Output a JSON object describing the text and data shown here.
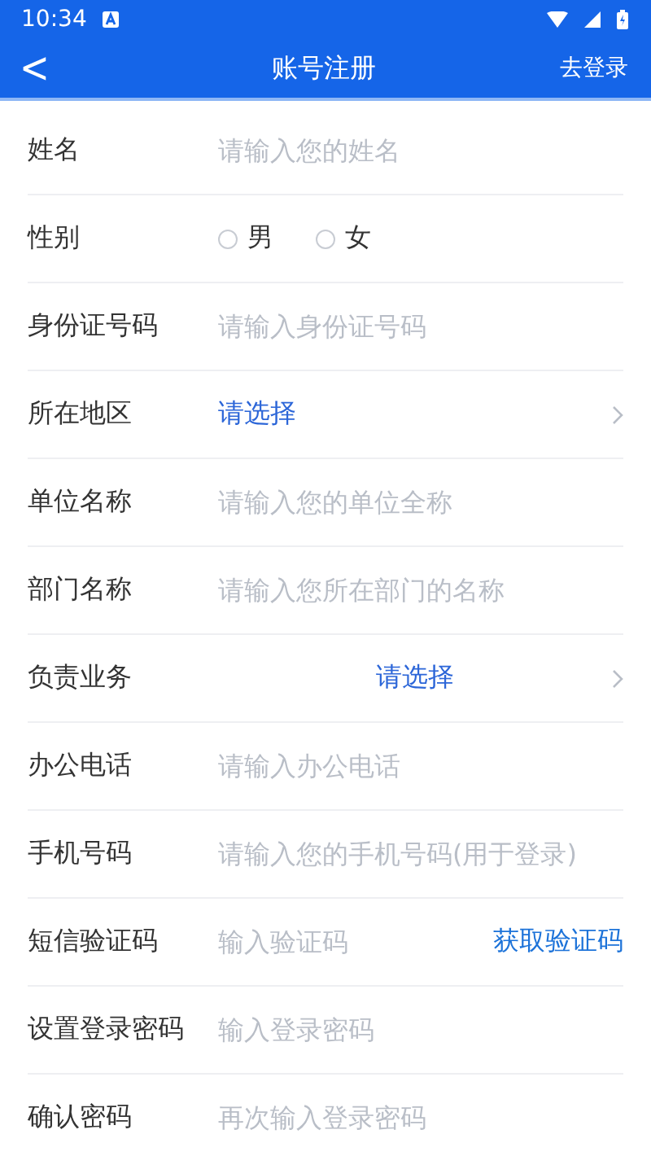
{
  "status_bar": {
    "time": "10:34"
  },
  "header": {
    "back": "<",
    "title": "账号注册",
    "action": "去登录"
  },
  "rows": [
    {
      "kind": "input",
      "label": "姓名",
      "placeholder": "请输入您的姓名"
    },
    {
      "kind": "radio",
      "label": "性别",
      "options": [
        {
          "label": "男",
          "selected": false
        },
        {
          "label": "女",
          "selected": false
        }
      ]
    },
    {
      "kind": "input",
      "label": "身份证号码",
      "placeholder": "请输入身份证号码"
    },
    {
      "kind": "select",
      "label": "所在地区",
      "value": "请选择"
    },
    {
      "kind": "input",
      "label": "单位名称",
      "placeholder": "请输入您的单位全称"
    },
    {
      "kind": "input",
      "label": "部门名称",
      "placeholder": "请输入您所在部门的名称"
    },
    {
      "kind": "centered_select",
      "label": "负责业务",
      "value": "请选择"
    },
    {
      "kind": "input",
      "label": "办公电话",
      "placeholder": "请输入办公电话"
    },
    {
      "kind": "input",
      "label": "手机号码",
      "placeholder": "请输入您的手机号码(用于登录)"
    },
    {
      "kind": "code",
      "label": "短信验证码",
      "placeholder": "输入验证码",
      "button": "获取验证码"
    },
    {
      "kind": "input",
      "label": "设置登录密码",
      "placeholder": "输入登录密码"
    },
    {
      "kind": "input",
      "label": "确认密码",
      "placeholder": "再次输入登录密码"
    }
  ]
}
